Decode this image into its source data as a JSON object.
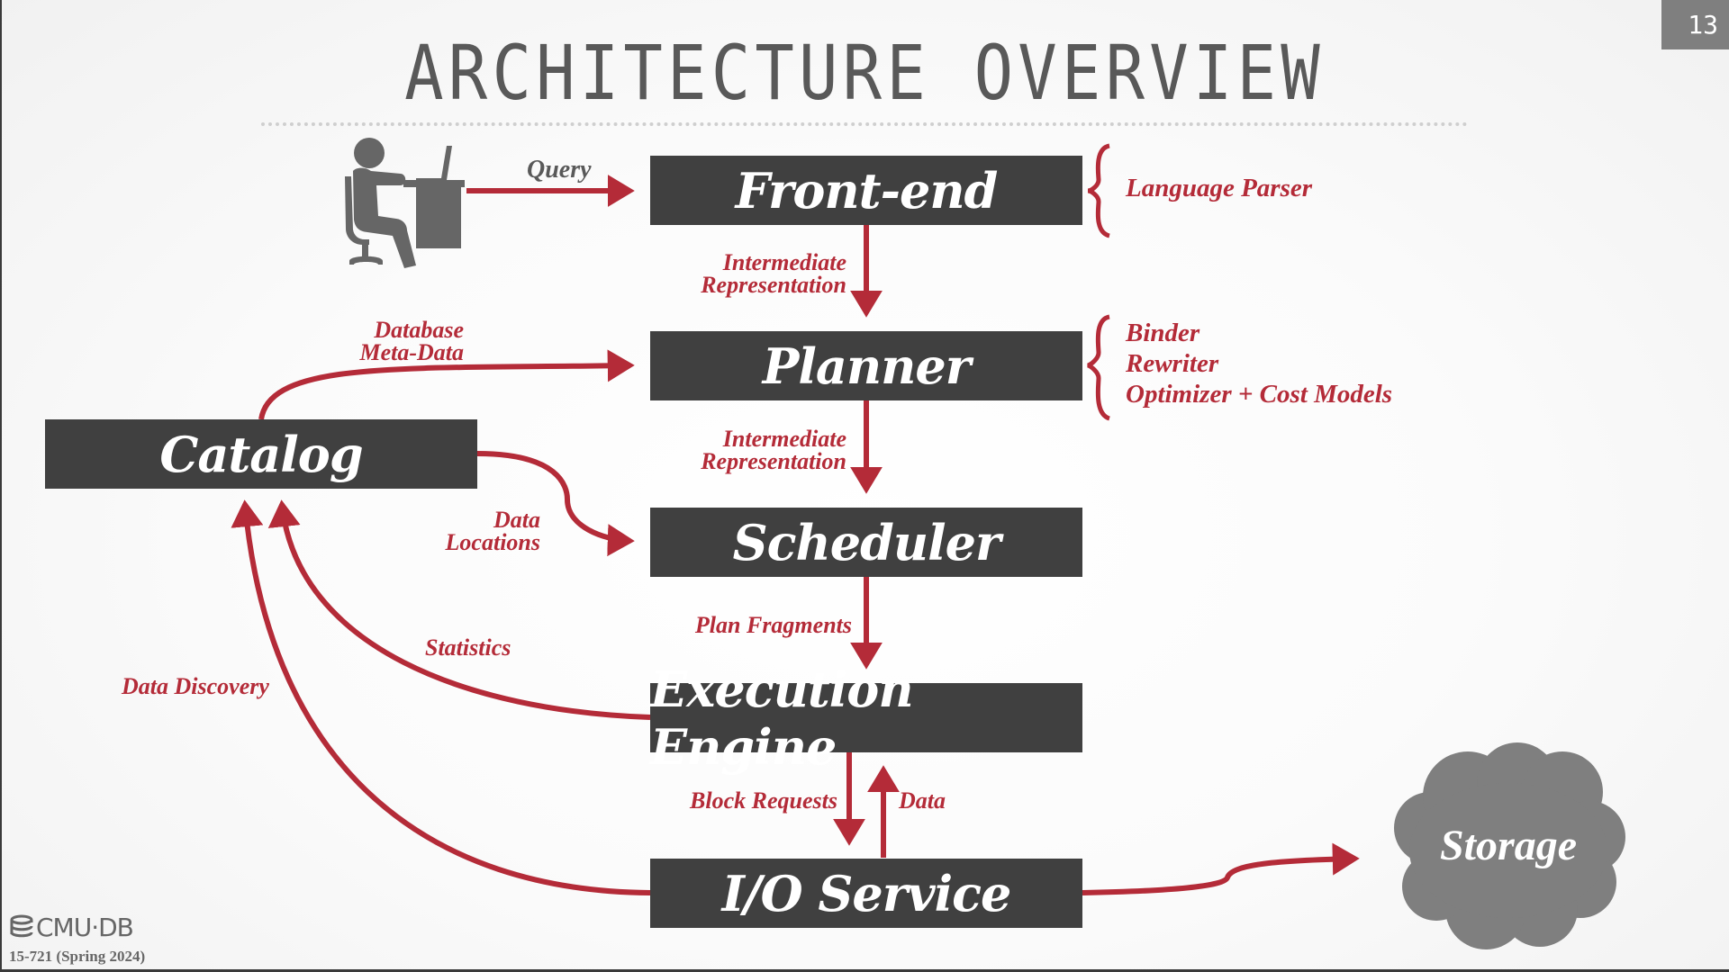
{
  "slide": {
    "title": "ARCHITECTURE OVERVIEW",
    "page_number": "13"
  },
  "components": {
    "front_end": "Front-end",
    "planner": "Planner",
    "scheduler": "Scheduler",
    "execution_engine": "Execution Engine",
    "io_service": "I/O Service",
    "catalog": "Catalog",
    "storage": "Storage"
  },
  "edges": {
    "query": "Query",
    "ir_1_line1": "Intermediate",
    "ir_1_line2": "Representation",
    "ir_2_line1": "Intermediate",
    "ir_2_line2": "Representation",
    "plan_fragments": "Plan Fragments",
    "block_requests": "Block Requests",
    "data": "Data",
    "db_meta_line1": "Database",
    "db_meta_line2": "Meta-Data",
    "data_locations_line1": "Data",
    "data_locations_line2": "Locations",
    "statistics": "Statistics",
    "data_discovery": "Data Discovery"
  },
  "annotations": {
    "front_end": [
      "Language Parser"
    ],
    "planner": [
      "Binder",
      "Rewriter",
      "Optimizer + Cost Models"
    ]
  },
  "footer": {
    "logo": "CMU·DB",
    "course": "15-721 (Spring 2024)"
  },
  "colors": {
    "accent": "#b42b38",
    "box": "#404040",
    "icon_gray": "#666666",
    "cloud": "#7f7f7f"
  }
}
